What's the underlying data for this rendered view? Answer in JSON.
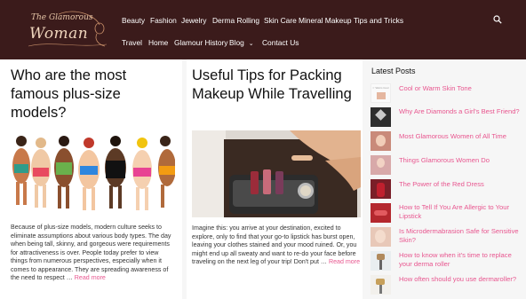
{
  "logo": {
    "line1": "The Glamorous",
    "line2": "Woman"
  },
  "nav": {
    "row1": [
      "Beauty",
      "Fashion",
      "Jewelry",
      "Derma Rolling",
      "Skin Care",
      "Mineral Makeup",
      "Tips and Tricks"
    ],
    "row2": [
      "Travel",
      "Home",
      "Glamour History",
      "Blog",
      "Contact Us"
    ],
    "search_icon": "search-icon",
    "dropdown_icon": "chevron-down-icon"
  },
  "posts": [
    {
      "title": "Who are the most famous plus-size models?",
      "excerpt": "Because of plus-size models, modern culture seeks to eliminate assumptions about various body types. The day when being tall, skinny, and gorgeous were requirements for attractiveness is over. People today prefer to view things from numerous perspectives, especially when it comes to appearance. They are spreading awareness of the need to respect … ",
      "read_more": "Read more"
    },
    {
      "title": "Useful Tips for Packing Makeup While Travelling",
      "excerpt": "Imagine this: you arrive at your destination, excited to explore, only to find that your go-to lipstick has burst open, leaving your clothes stained and your mood ruined. Or, you might end up all sweaty and want to re-do your face before traveling on the next leg of your trip! Don't put … ",
      "read_more": "Read more"
    }
  ],
  "sidebar": {
    "title": "Latest Posts",
    "items": [
      {
        "label": "Cool or Warm Skin Tone",
        "thumb_text": "☆ Warm Cool"
      },
      {
        "label": "Why Are Diamonds a Girl's Best Friend?"
      },
      {
        "label": "Most Glamorous Women of All Time"
      },
      {
        "label": "Things Glamorous Women Do"
      },
      {
        "label": "The Power of the Red Dress"
      },
      {
        "label": "How to Tell If You Are Allergic to Your Lipstick"
      },
      {
        "label": "Is Microdermabrasion Safe for Sensitive Skin?"
      },
      {
        "label": "How to know when it's time to replace your derma roller"
      },
      {
        "label": "How often should you use dermaroller?"
      }
    ]
  },
  "colors": {
    "header_bg": "#3b1b1b",
    "accent": "#e8568f",
    "text": "#111111"
  }
}
